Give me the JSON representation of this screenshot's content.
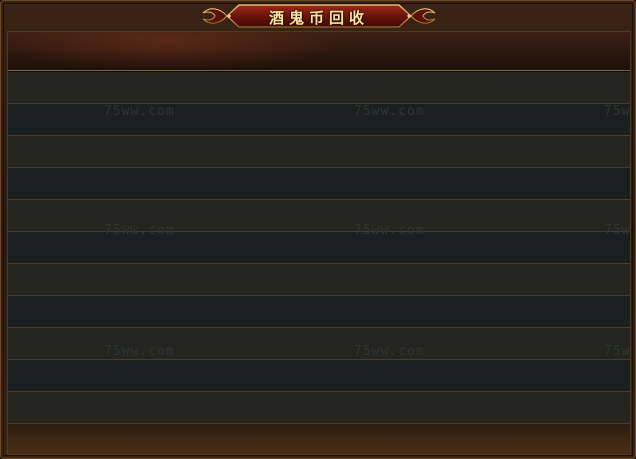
{
  "window": {
    "title": "酒鬼币回收"
  },
  "list": {
    "row_count": 11
  },
  "watermarks": [
    {
      "text": "75ww.com"
    },
    {
      "text": "75ww.com"
    },
    {
      "text": "75ww"
    },
    {
      "text": "75ww.com"
    },
    {
      "text": "75ww.com"
    },
    {
      "text": "75ww"
    },
    {
      "text": "75ww.com"
    },
    {
      "text": "75ww.com"
    },
    {
      "text": "75ww"
    }
  ],
  "colors": {
    "frame_border": "#6b4a2a",
    "title_text": "#f6e2a2",
    "row_odd": "#25251f",
    "row_even": "#182120",
    "row_divider": "#4c3a22"
  }
}
